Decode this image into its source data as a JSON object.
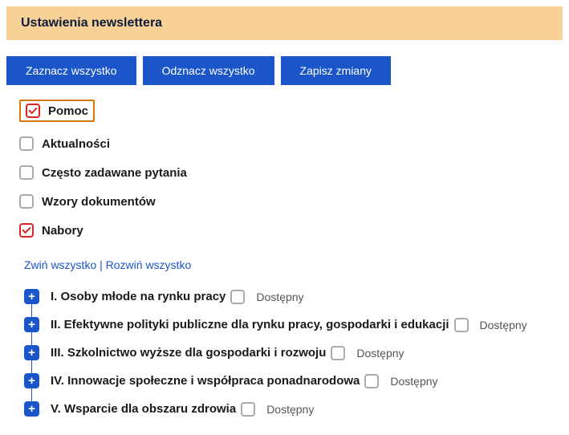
{
  "header": {
    "title": "Ustawienia newslettera"
  },
  "buttons": {
    "select_all": "Zaznacz wszystko",
    "deselect_all": "Odznacz wszystko",
    "save": "Zapisz zmiany"
  },
  "checkboxes": [
    {
      "label": "Pomoc",
      "checked": true,
      "highlighted": true
    },
    {
      "label": "Aktualności",
      "checked": false,
      "highlighted": false
    },
    {
      "label": "Często zadawane pytania",
      "checked": false,
      "highlighted": false
    },
    {
      "label": "Wzory dokumentów",
      "checked": false,
      "highlighted": false
    },
    {
      "label": "Nabory",
      "checked": true,
      "highlighted": false
    }
  ],
  "tree_controls": {
    "collapse_all": "Zwiń wszystko",
    "separator": " | ",
    "expand_all": "Rozwiń wszystko"
  },
  "tree": [
    {
      "label": "I. Osoby młode na rynku pracy",
      "sub": "Dostępny",
      "checked": false
    },
    {
      "label": "II. Efektywne polityki publiczne dla rynku pracy, gospodarki i edukacji",
      "sub": "Dostępny",
      "checked": false
    },
    {
      "label": "III. Szkolnictwo wyższe dla gospodarki i rozwoju",
      "sub": "Dostępny",
      "checked": false
    },
    {
      "label": "IV. Innowacje społeczne i współpraca ponadnarodowa",
      "sub": "Dostępny",
      "checked": false
    },
    {
      "label": "V. Wsparcie dla obszaru zdrowia",
      "sub": "Dostępny",
      "checked": false
    }
  ]
}
